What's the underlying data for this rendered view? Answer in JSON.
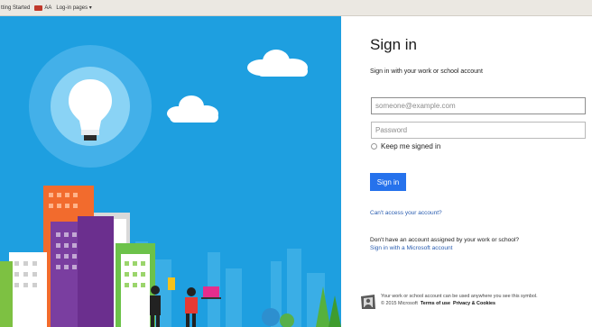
{
  "bookmarks": {
    "items": [
      {
        "label": "tting Started"
      },
      {
        "label": "AA"
      },
      {
        "label": "Log-in pages ▾"
      }
    ]
  },
  "signin": {
    "title": "Sign in",
    "subtitle": "Sign in with your work or school account",
    "email_placeholder": "someone@example.com",
    "password_placeholder": "Password",
    "keep_signed_in": "Keep me signed in",
    "button": "Sign in",
    "cant_access": "Can't access your account?",
    "no_account_text": "Don't have an account assigned by your work or school?",
    "ms_account_link": "Sign in with a Microsoft account"
  },
  "footer": {
    "line1": "Your work or school account can be used anywhere you see this symbol.",
    "copyright": "© 2015 Microsoft",
    "terms": "Terms of use",
    "privacy": "Privacy & Cookies"
  },
  "colors": {
    "sky": "#1e9fe0",
    "accent": "#2672ec",
    "link": "#2a5db0"
  }
}
